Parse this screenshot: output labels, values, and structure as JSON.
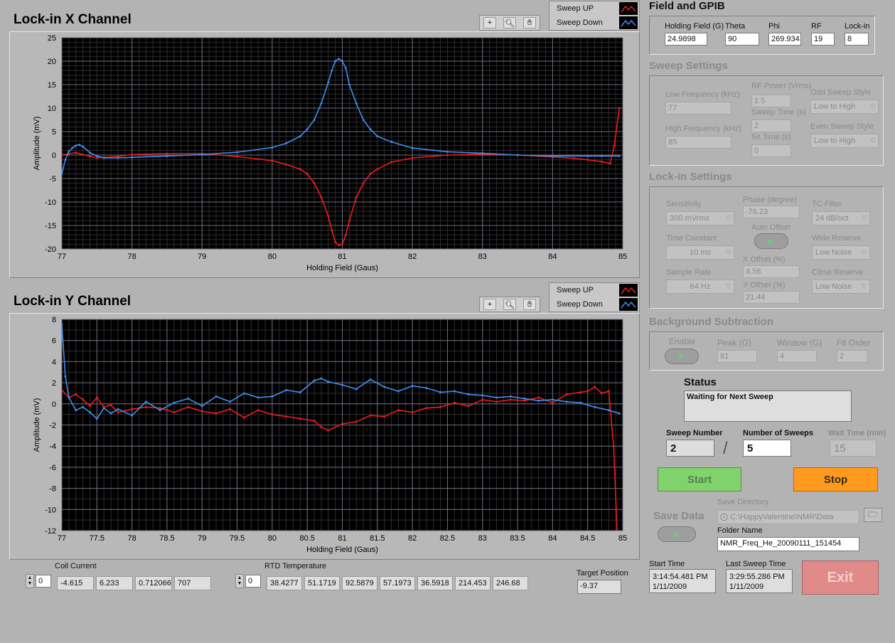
{
  "graph_x": {
    "title": "Lock-in X Channel",
    "legend": {
      "up": "Sweep UP",
      "down": "Sweep Down"
    }
  },
  "graph_y": {
    "title": "Lock-in Y Channel",
    "legend": {
      "up": "Sweep UP",
      "down": "Sweep Down"
    }
  },
  "colors": {
    "sweep_up": "#ee1c1c",
    "sweep_down": "#3f8ff0",
    "plot_bg": "#000000",
    "grid": "#5a5a5a"
  },
  "chart_data": [
    {
      "type": "line",
      "title": "Lock-in X Channel",
      "xlabel": "Holding Field (Gaus)",
      "ylabel": "Amplitude (mV)",
      "xlim": [
        77,
        85
      ],
      "ylim": [
        -20,
        25
      ],
      "xticks": [
        "77",
        "78",
        "79",
        "80",
        "81",
        "82",
        "83",
        "84",
        "85"
      ],
      "xtick_values": [
        77,
        78,
        79,
        80,
        81,
        82,
        83,
        84,
        85
      ],
      "yticks": [
        "25",
        "20",
        "15",
        "10",
        "5",
        "0",
        "-5",
        "-10",
        "-15",
        "-20"
      ],
      "ytick_values": [
        25,
        20,
        15,
        10,
        5,
        0,
        -5,
        -10,
        -15,
        -20
      ],
      "series": [
        {
          "name": "Sweep UP",
          "color": "#ee1c1c",
          "x": [
            77,
            77.1,
            77.2,
            77.3,
            77.4,
            77.5,
            77.6,
            77.8,
            78,
            78.5,
            79,
            79.5,
            80,
            80.2,
            80.4,
            80.5,
            80.6,
            80.7,
            80.8,
            80.85,
            80.9,
            80.95,
            81,
            81.05,
            81.1,
            81.2,
            81.3,
            81.4,
            81.5,
            81.7,
            82,
            82.5,
            83,
            83.5,
            84,
            84.3,
            84.5,
            84.7,
            84.82,
            84.88,
            84.95
          ],
          "y": [
            0,
            0.3,
            0.5,
            0.1,
            -0.3,
            -0.6,
            -0.5,
            -0.3,
            0.1,
            0.3,
            0.3,
            -0.3,
            -1.2,
            -2,
            -3,
            -4,
            -6,
            -9,
            -13,
            -16,
            -18.5,
            -19.2,
            -19,
            -17,
            -14,
            -9,
            -6,
            -4,
            -3,
            -1.5,
            -0.6,
            0,
            0.2,
            0,
            -0.4,
            -0.7,
            -1,
            -1.4,
            -1.8,
            2,
            10
          ]
        },
        {
          "name": "Sweep Down",
          "color": "#3f8ff0",
          "x": [
            77,
            77.05,
            77.1,
            77.15,
            77.2,
            77.25,
            77.3,
            77.4,
            77.5,
            77.6,
            77.8,
            78,
            78.5,
            79,
            79.5,
            80,
            80.2,
            80.4,
            80.5,
            80.6,
            80.7,
            80.8,
            80.85,
            80.9,
            80.95,
            81,
            81.05,
            81.1,
            81.2,
            81.3,
            81.4,
            81.5,
            81.7,
            82,
            82.5,
            83,
            83.5,
            84,
            84.5,
            84.7,
            84.95
          ],
          "y": [
            -4,
            -1,
            0.8,
            1.5,
            2,
            2.2,
            1.8,
            0.5,
            -0.2,
            -0.6,
            -0.6,
            -0.5,
            -0.2,
            0.1,
            0.6,
            1.6,
            2.5,
            4,
            5.5,
            7.5,
            11,
            15.5,
            18,
            20,
            20.5,
            20,
            18.5,
            15,
            11,
            7.5,
            5.5,
            4,
            2.8,
            1.5,
            0.7,
            0.4,
            0,
            -0.2,
            -0.2,
            -0.2,
            -0.2
          ]
        }
      ],
      "grid": true
    },
    {
      "type": "line",
      "title": "Lock-in Y Channel",
      "xlabel": "Holding Field (Gaus)",
      "ylabel": "Amplitude (mV)",
      "xlim": [
        77,
        85
      ],
      "ylim": [
        -12,
        8
      ],
      "xticks": [
        "77",
        "77.5",
        "78",
        "78.5",
        "79",
        "79.5",
        "80",
        "80.5",
        "81",
        "81.5",
        "82",
        "82.5",
        "83",
        "83.5",
        "84",
        "84.5",
        "85"
      ],
      "xtick_values": [
        77,
        77.5,
        78,
        78.5,
        79,
        79.5,
        80,
        80.5,
        81,
        81.5,
        82,
        82.5,
        83,
        83.5,
        84,
        84.5,
        85
      ],
      "yticks": [
        "8",
        "6",
        "4",
        "2",
        "0",
        "-2",
        "-4",
        "-6",
        "-8",
        "-10",
        "-12"
      ],
      "ytick_values": [
        8,
        6,
        4,
        2,
        0,
        -2,
        -4,
        -6,
        -8,
        -10,
        -12
      ],
      "series": [
        {
          "name": "Sweep UP",
          "color": "#ee1c1c",
          "x": [
            77,
            77.1,
            77.2,
            77.3,
            77.4,
            77.5,
            77.6,
            77.7,
            77.8,
            78,
            78.2,
            78.4,
            78.6,
            78.8,
            79,
            79.2,
            79.4,
            79.6,
            79.8,
            80,
            80.2,
            80.4,
            80.6,
            80.7,
            80.8,
            81,
            81.2,
            81.4,
            81.6,
            81.8,
            82,
            82.2,
            82.4,
            82.6,
            82.8,
            83,
            83.2,
            83.4,
            83.6,
            83.8,
            84,
            84.2,
            84.4,
            84.5,
            84.6,
            84.7,
            84.8,
            84.87,
            84.92
          ],
          "y": [
            1.3,
            0.6,
            0.9,
            0.4,
            -0.2,
            0.6,
            -0.3,
            -0.1,
            -0.8,
            -0.5,
            -0.3,
            -0.4,
            -0.8,
            -0.3,
            -0.7,
            -0.9,
            -0.5,
            -1.3,
            -0.6,
            -1,
            -1.2,
            -1.4,
            -1.6,
            -2.2,
            -2.5,
            -1.9,
            -1.7,
            -1.1,
            -1.2,
            -0.6,
            -0.8,
            -0.4,
            -0.3,
            0.1,
            -0.2,
            0.4,
            0.2,
            0.4,
            0.3,
            0.6,
            0.1,
            0.9,
            1.1,
            1.2,
            1.6,
            1,
            1.2,
            -4,
            -12
          ]
        },
        {
          "name": "Sweep Down",
          "color": "#3f8ff0",
          "x": [
            77,
            77.05,
            77.1,
            77.2,
            77.3,
            77.4,
            77.5,
            77.6,
            77.7,
            77.8,
            78,
            78.2,
            78.4,
            78.6,
            78.8,
            79,
            79.2,
            79.4,
            79.6,
            79.8,
            80,
            80.2,
            80.4,
            80.6,
            80.7,
            80.8,
            81,
            81.2,
            81.4,
            81.6,
            81.8,
            82,
            82.2,
            82.4,
            82.6,
            82.8,
            83,
            83.2,
            83.4,
            83.6,
            83.8,
            84,
            84.2,
            84.4,
            84.6,
            84.8,
            84.95
          ],
          "y": [
            7.5,
            2.6,
            0.6,
            -0.6,
            -0.3,
            -0.8,
            -1.4,
            -0.4,
            -0.9,
            -0.5,
            -1.1,
            0.2,
            -0.6,
            0.1,
            0.5,
            -0.2,
            0.7,
            0.2,
            1,
            0.6,
            0.7,
            1.3,
            1.1,
            2.2,
            2.4,
            2.1,
            1.8,
            1.4,
            2.3,
            1.6,
            1.2,
            1.7,
            1.5,
            1.1,
            1.2,
            0.9,
            0.8,
            0.6,
            0.7,
            0.5,
            0.3,
            0.4,
            0.2,
            0.1,
            -0.3,
            -0.6,
            -0.9
          ]
        }
      ],
      "grid": true
    }
  ],
  "field_gpib": {
    "title": "Field and GPIB",
    "holding_field_label": "Holding Field (G)",
    "holding_field": "24.9898",
    "theta_label": "Theta",
    "theta": "90",
    "phi_label": "Phi",
    "phi": "269.934",
    "rf_label": "RF",
    "rf": "19",
    "lockin_label": "Lock-in",
    "lockin": "8"
  },
  "sweep_settings": {
    "title": "Sweep Settings",
    "low_freq_label": "Low Frequency (kHz)",
    "low_freq": "77",
    "high_freq_label": "High Frequency (kHz)",
    "high_freq": "85",
    "rf_power_label": "RF Power (Vrms)",
    "rf_power": "1.5",
    "sweep_time_label": "Sweep Time (s)",
    "sweep_time": "2",
    "sit_time_label": "Sit Time (s)",
    "sit_time": "0",
    "odd_style_label": "Odd Sweep Style",
    "odd_style": "Low to High",
    "even_style_label": "Even Sweep Style",
    "even_style": "Low to High"
  },
  "lockin_settings": {
    "title": "Lock-in Settings",
    "sensitivity_label": "Sensitivity",
    "sensitivity": "300 mVrms",
    "time_constant_label": "Time Constant",
    "time_constant": "10 ms",
    "sample_rate_label": "Sample Rate",
    "sample_rate": "64 Hz",
    "phase_label": "Phase (degree)",
    "phase": "-76.23",
    "auto_offset_label": "Auto Offset",
    "x_offset_label": "X Offset (%)",
    "x_offset": "4.56",
    "y_offset_label": "Y Offset (%)",
    "y_offset": "21.44",
    "tc_filter_label": "TC Filter",
    "tc_filter": "24 dB/oct",
    "wide_reserve_label": "Wide Reserve",
    "wide_reserve": "Low Noise",
    "close_reserve_label": "Close Reserve",
    "close_reserve": "Low Noise"
  },
  "background": {
    "title": "Background Subtraction",
    "enable_label": "Enable",
    "peak_label": "Peak (G)",
    "peak": "81",
    "window_label": "Window (G)",
    "window": "4",
    "fit_order_label": "Fit Order",
    "fit_order": "2"
  },
  "status": {
    "label": "Status",
    "text": "Waiting for Next Sweep",
    "sweep_number_label": "Sweep Number",
    "sweep_number": "2",
    "separator": "/",
    "num_sweeps_label": "Number of Sweeps",
    "num_sweeps": "5",
    "wait_time_label": "Wait Time (min)",
    "wait_time": "15"
  },
  "buttons": {
    "start": "Start",
    "stop": "Stop",
    "exit": "Exit",
    "save_data": "Save Data"
  },
  "save": {
    "directory_label": "Save Directory",
    "directory": "C:\\HappyValentine\\NMR\\Data",
    "folder_label": "Folder Name",
    "folder": "NMR_Freq_He_20090111_151454"
  },
  "times": {
    "start_label": "Start Time",
    "start_time": "3:14:54.481 PM",
    "start_date": "1/11/2009",
    "last_label": "Last Sweep Time",
    "last_time": "3:29:55.286 PM",
    "last_date": "1/11/2009"
  },
  "coil": {
    "label": "Coil Current",
    "index": "0",
    "values": [
      "-4.615",
      "6.233",
      "0.712066",
      "707"
    ]
  },
  "rtd": {
    "label": "RTD Temperature",
    "index": "0",
    "values": [
      "38.4277",
      "51.1719",
      "92.5879",
      "57.1973",
      "36.5918",
      "214.453",
      "246.68"
    ]
  },
  "target": {
    "label": "Target Position",
    "value": "-9.37"
  }
}
